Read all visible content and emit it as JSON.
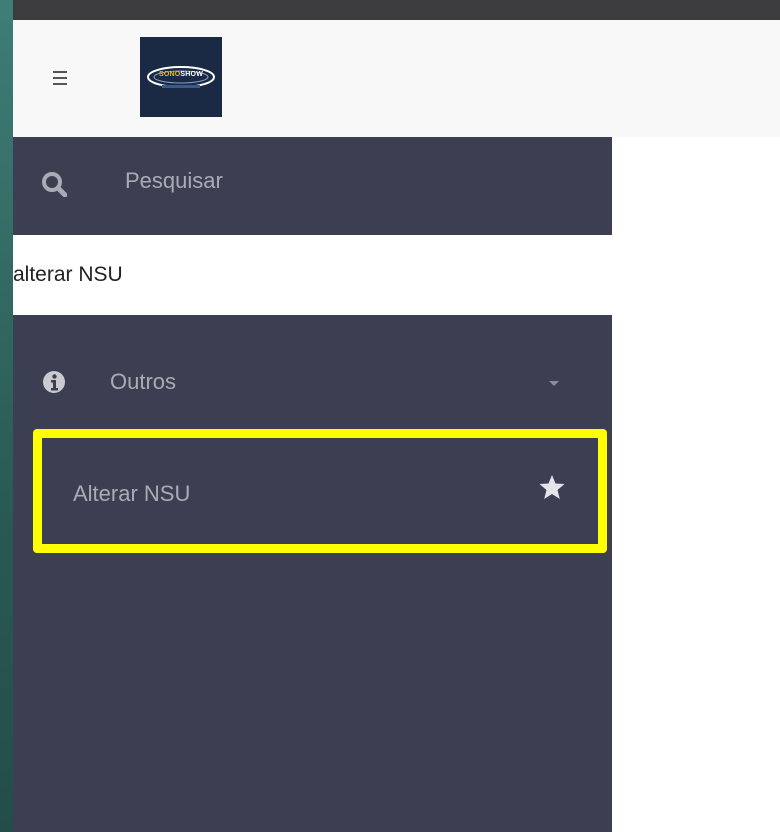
{
  "header": {
    "menu_icon": "hamburger-icon",
    "logo_text_primary": "SONO",
    "logo_text_secondary": "SHOW"
  },
  "sidebar": {
    "search_label": "Pesquisar",
    "search_icon": "search-icon",
    "search_value": "alterar NSU",
    "group": {
      "label": "Outros",
      "icon": "info-icon",
      "expand_icon": "caret-down-icon"
    },
    "items": [
      {
        "label": "Alterar NSU",
        "favorite_icon": "star-icon",
        "highlighted": true
      }
    ]
  },
  "colors": {
    "sidebar_bg": "#3b3f51",
    "sidebar_text": "#a9acb5",
    "header_bg": "#f8f8f8",
    "highlight": "#ffff00",
    "logo_bg": "#1a2a44"
  }
}
